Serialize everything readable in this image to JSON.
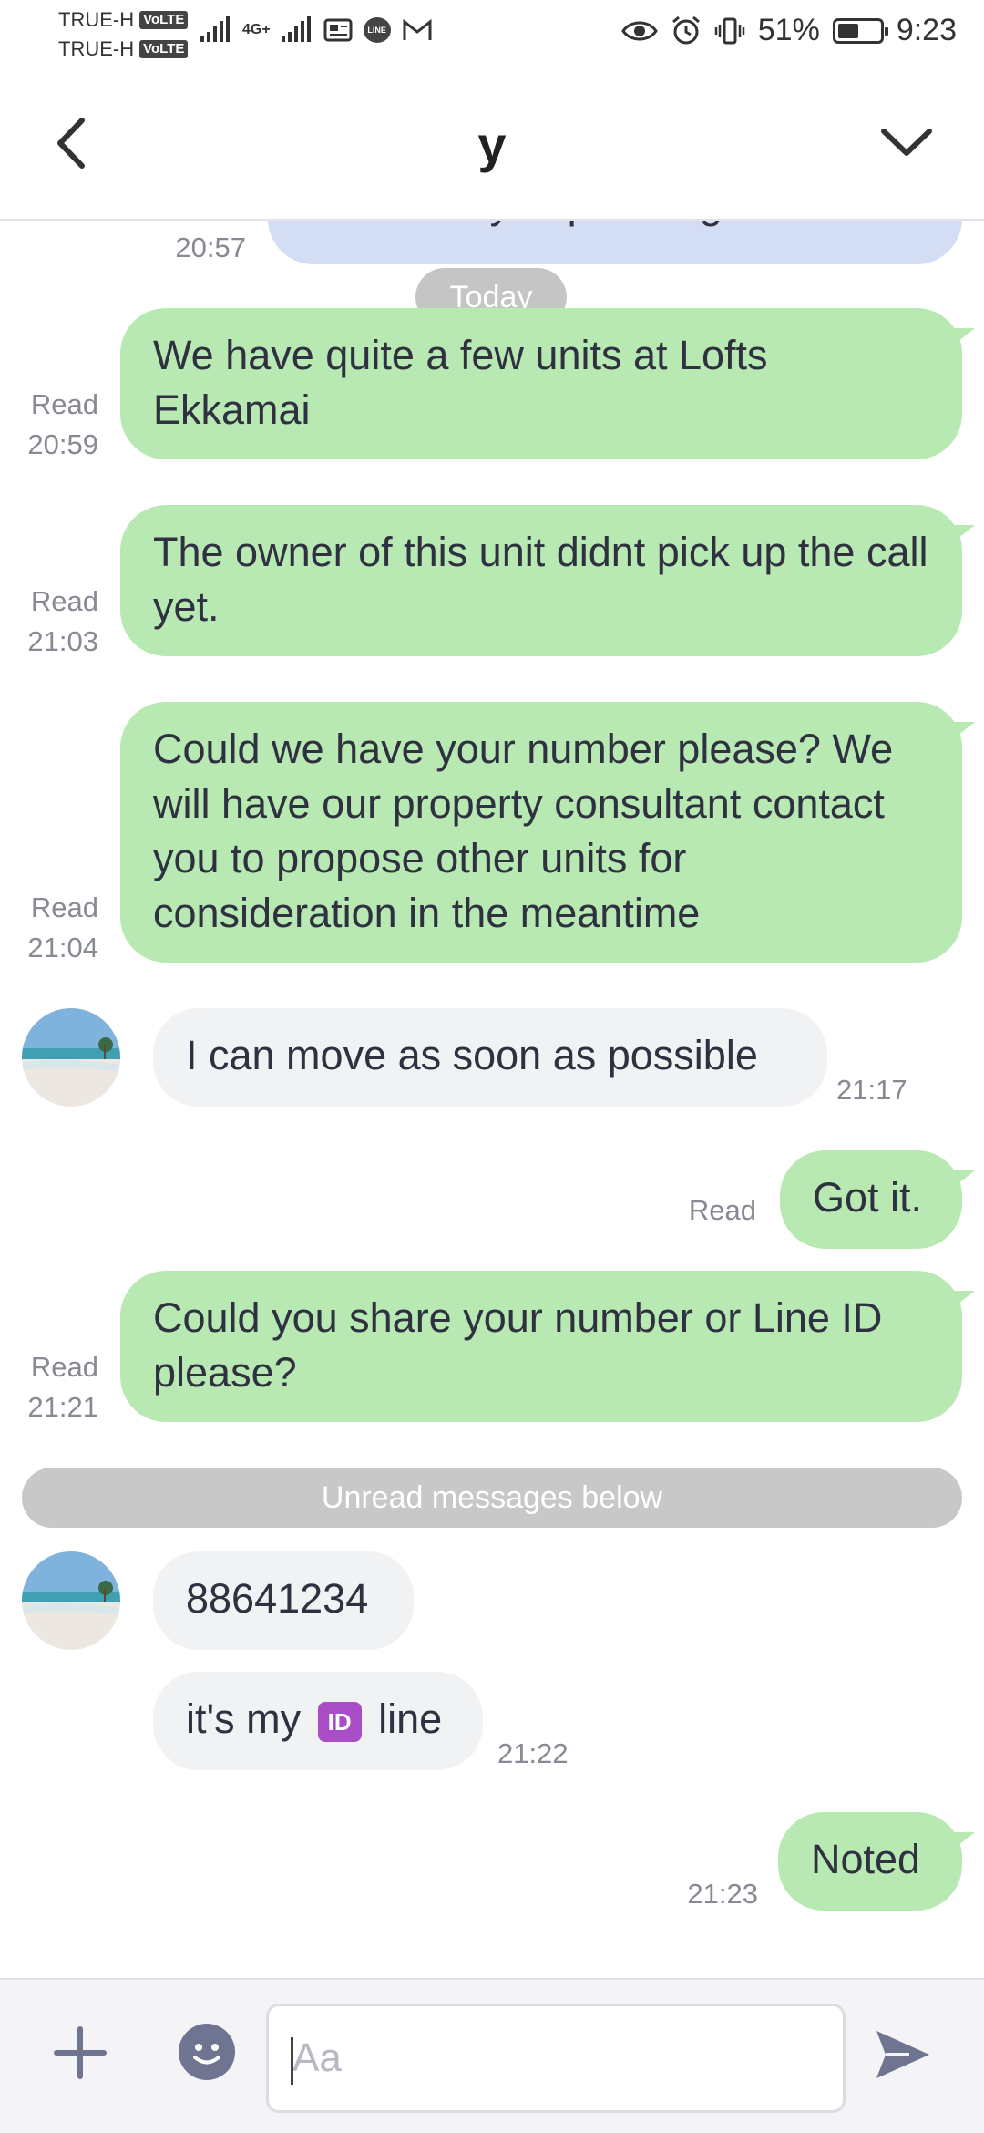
{
  "status_bar": {
    "carrier1": "TRUE-H",
    "carrier2": "TRUE-H",
    "volte_label": "VoLTE",
    "network_label": "4G+",
    "battery": "51%",
    "battery_level": 0.51,
    "time": "9:23"
  },
  "header": {
    "title": "y"
  },
  "chat": {
    "previous": {
      "text": "When are you planning to move?",
      "time": "20:57"
    },
    "date_divider": "Today",
    "msg1": {
      "text": "We have quite a few units at Lofts Ekkamai",
      "status": "Read",
      "time": "20:59"
    },
    "msg2": {
      "text": "The owner of this unit didnt pick up the call yet.",
      "status": "Read",
      "time": "21:03"
    },
    "msg3": {
      "text": "Could we have your number please? We will have our property consultant contact you to propose other units for consideration in the meantime",
      "status": "Read",
      "time": "21:04"
    },
    "msg4": {
      "text": "I can move as soon as possible",
      "time": "21:17"
    },
    "msg5": {
      "text": "Got it.",
      "status": "Read"
    },
    "msg6": {
      "text": "Could you share your number or Line ID please?",
      "status": "Read",
      "time": "21:21"
    },
    "unread_divider": "Unread messages below",
    "msg7": {
      "text": "88641234"
    },
    "msg8": {
      "text_before": "it's my",
      "emoji": "ID",
      "text_after": "line",
      "time": "21:22"
    },
    "msg9": {
      "text": "Noted",
      "time": "21:23"
    }
  },
  "footer": {
    "input_placeholder": "Aa"
  },
  "colors": {
    "outgoing_bubble": "#b8e9b3",
    "incoming_bubble": "#f1f2f4",
    "accent_icon": "#6f7591"
  }
}
